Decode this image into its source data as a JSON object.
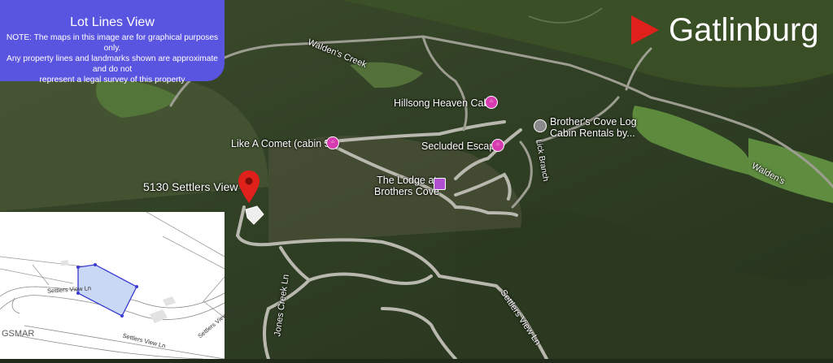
{
  "info": {
    "title": "Lot Lines View",
    "note_lines": [
      "NOTE: The maps in this image are for graphical purposes only.",
      "Any property lines and landmarks shown are approximate and do not",
      "represent a legal survey of this property"
    ]
  },
  "destination": {
    "label": "Gatlinburg",
    "arrow_color": "#e0201b"
  },
  "property": {
    "address": "5130 Settlers View Ln",
    "pin_color": "#e0201b"
  },
  "places": {
    "hillsong": "Hillsong Heaven Cabin",
    "comet": "Like A Comet (cabin 51)",
    "secluded": "Secluded Escape",
    "brothers_cove_line1": "Brother's Cove Log",
    "brothers_cove_line2": "Cabin Rentals by...",
    "lodge_line1": "The Lodge at",
    "lodge_line2": "Brothers Cove"
  },
  "roads": {
    "walden_creek_top": "Walden's Creek",
    "walden_right": "Walden's",
    "lick_branch": "Lick Branch",
    "jones_creek": "Jones Creek Ln",
    "settlers_view": "Settlers View Ln"
  },
  "inset": {
    "road_label_1": "Settlers View Ln",
    "road_label_2": "Settlers View Ln",
    "road_label_3": "Settlers View Ln",
    "watermark": "GSMAR"
  },
  "colors": {
    "info_box": "#5a55e0",
    "poi_pink": "#d63cb0",
    "lot_fill": "#c9d8f5"
  }
}
